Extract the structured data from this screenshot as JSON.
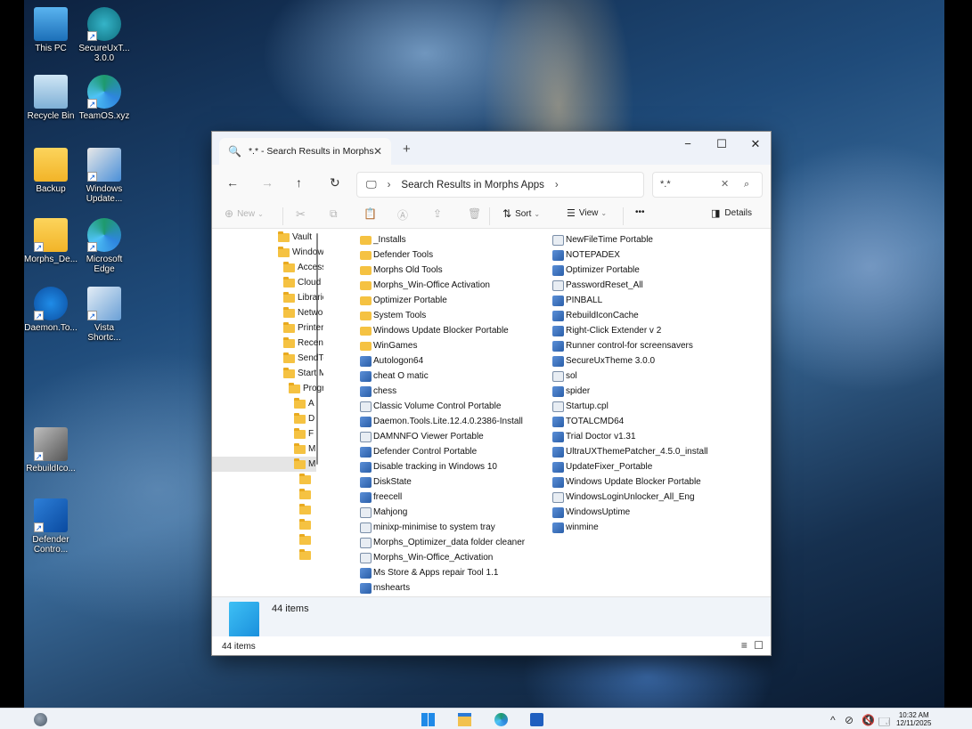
{
  "desktop": {
    "icons": [
      {
        "label": "This PC",
        "icon": "computer-icon"
      },
      {
        "label": "SecureUxT... 3.0.0",
        "icon": "securux-icon"
      },
      {
        "label": "Recycle Bin",
        "icon": "recycle-bin-icon"
      },
      {
        "label": "TeamOS.xyz",
        "icon": "edge-icon"
      },
      {
        "label": "Backup",
        "icon": "folder-icon"
      },
      {
        "label": "Windows Update...",
        "icon": "windows-update-icon"
      },
      {
        "label": "Morphs_De...",
        "icon": "folder-icon"
      },
      {
        "label": "Microsoft Edge",
        "icon": "edge-icon"
      },
      {
        "label": "Daemon.To...",
        "icon": "daemon-tools-icon"
      },
      {
        "label": "Vista Shortc...",
        "icon": "vista-icon"
      },
      {
        "label": "RebuildIco...",
        "icon": "rebuild-icon"
      },
      {
        "label": "Defender Contro...",
        "icon": "defender-icon"
      }
    ]
  },
  "window": {
    "tab_title": "*.* - Search Results in Morphs",
    "new_tab": "+",
    "controls": {
      "minimize": "−",
      "maximize": "☐",
      "close": "✕"
    },
    "nav": {
      "back": "←",
      "forward": "→",
      "up": "↑",
      "refresh": "↻"
    },
    "address": {
      "crumb": "Search Results in Morphs Apps"
    },
    "search": {
      "value": "*.*"
    },
    "commands": {
      "new": "New",
      "sort": "Sort",
      "view": "View",
      "more": "•••",
      "details": "Details"
    },
    "nav_pane": [
      {
        "label": "Vault",
        "indent": 0
      },
      {
        "label": "Windows",
        "indent": 0
      },
      {
        "label": "Accessories",
        "indent": 1
      },
      {
        "label": "Cloud",
        "indent": 1
      },
      {
        "label": "Libraries",
        "indent": 1
      },
      {
        "label": "Network",
        "indent": 1
      },
      {
        "label": "Printers",
        "indent": 1
      },
      {
        "label": "Recent",
        "indent": 1
      },
      {
        "label": "SendTo",
        "indent": 1
      },
      {
        "label": "Start Menu",
        "indent": 1
      },
      {
        "label": "Programs",
        "indent": 2
      },
      {
        "label": "A",
        "indent": 3
      },
      {
        "label": "D",
        "indent": 3
      },
      {
        "label": "F",
        "indent": 3
      },
      {
        "label": "M",
        "indent": 3
      },
      {
        "label": "M",
        "indent": 3,
        "selected": true
      },
      {
        "label": "",
        "indent": 4
      },
      {
        "label": "",
        "indent": 4
      },
      {
        "label": "",
        "indent": 4
      },
      {
        "label": "",
        "indent": 4
      },
      {
        "label": "",
        "indent": 4
      },
      {
        "label": "",
        "indent": 4
      }
    ],
    "files_col1": [
      {
        "name": "_Installs",
        "type": "folder"
      },
      {
        "name": "Defender Tools",
        "type": "folder"
      },
      {
        "name": "Morphs Old Tools",
        "type": "folder"
      },
      {
        "name": "Morphs_Win-Office Activation",
        "type": "folder"
      },
      {
        "name": "Optimizer Portable",
        "type": "folder"
      },
      {
        "name": "System Tools",
        "type": "folder"
      },
      {
        "name": "Windows Update Blocker Portable",
        "type": "folder"
      },
      {
        "name": "WinGames",
        "type": "folder"
      },
      {
        "name": "Autologon64",
        "type": "app"
      },
      {
        "name": "cheat O matic",
        "type": "app"
      },
      {
        "name": "chess",
        "type": "app"
      },
      {
        "name": "Classic Volume Control Portable",
        "type": "doc"
      },
      {
        "name": "Daemon.Tools.Lite.12.4.0.2386-Install",
        "type": "app"
      },
      {
        "name": "DAMNNFO Viewer Portable",
        "type": "doc"
      },
      {
        "name": "Defender Control Portable",
        "type": "app"
      },
      {
        "name": "Disable tracking in Windows 10",
        "type": "app"
      },
      {
        "name": "DiskState",
        "type": "app"
      },
      {
        "name": "freecell",
        "type": "app"
      },
      {
        "name": "Mahjong",
        "type": "doc"
      },
      {
        "name": "minixp-minimise to system tray",
        "type": "doc"
      },
      {
        "name": "Morphs_Optimizer_data folder cleaner",
        "type": "doc"
      },
      {
        "name": "Morphs_Win-Office_Activation",
        "type": "doc"
      },
      {
        "name": "Ms Store & Apps repair Tool 1.1",
        "type": "app"
      },
      {
        "name": "mshearts",
        "type": "app"
      }
    ],
    "files_col2": [
      {
        "name": "NewFileTime Portable",
        "type": "doc"
      },
      {
        "name": "NOTEPADEX",
        "type": "app"
      },
      {
        "name": "Optimizer Portable",
        "type": "app"
      },
      {
        "name": "PasswordReset_All",
        "type": "doc"
      },
      {
        "name": "PINBALL",
        "type": "app"
      },
      {
        "name": "RebuildIconCache",
        "type": "app"
      },
      {
        "name": "Right-Click Extender v 2",
        "type": "app"
      },
      {
        "name": "Runner control-for screensavers",
        "type": "app"
      },
      {
        "name": "SecureUxTheme 3.0.0",
        "type": "app"
      },
      {
        "name": "sol",
        "type": "doc"
      },
      {
        "name": "spider",
        "type": "app"
      },
      {
        "name": "Startup.cpl",
        "type": "doc"
      },
      {
        "name": "TOTALCMD64",
        "type": "app"
      },
      {
        "name": "Trial Doctor v1.31",
        "type": "app"
      },
      {
        "name": "UltraUXThemePatcher_4.5.0_install",
        "type": "app"
      },
      {
        "name": "UpdateFixer_Portable",
        "type": "app"
      },
      {
        "name": "Windows Update Blocker Portable",
        "type": "app"
      },
      {
        "name": "WindowsLoginUnlocker_All_Eng",
        "type": "doc"
      },
      {
        "name": "WindowsUptime",
        "type": "app"
      },
      {
        "name": "winmine",
        "type": "app"
      }
    ],
    "details_count": "44 items",
    "status_count": "44 items"
  },
  "taskbar": {
    "clock_time": "10:32 AM",
    "clock_date": "12/11/2025"
  },
  "colors": {
    "folder": "#f5c242",
    "accent": "#0b5cd5",
    "details_bg": "#f0f4f9"
  }
}
